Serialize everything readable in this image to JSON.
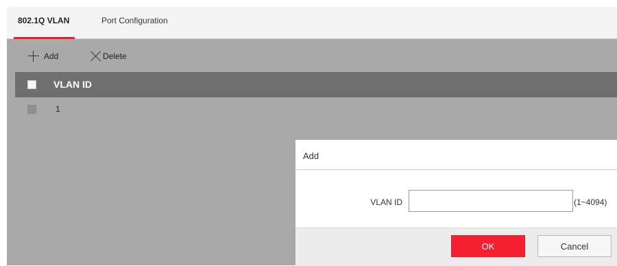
{
  "tabs": [
    {
      "label": "802.1Q VLAN",
      "active": true
    },
    {
      "label": "Port Configuration",
      "active": false
    }
  ],
  "toolbar": {
    "add_label": "Add",
    "add_icon": "plus-icon",
    "delete_label": "Delete",
    "delete_icon": "close-icon"
  },
  "table": {
    "header": "VLAN ID",
    "rows": [
      {
        "vlan_id": "1"
      }
    ]
  },
  "dialog": {
    "title": "Add",
    "field_label": "VLAN ID",
    "field_value": "",
    "field_hint": "(1~4094)",
    "ok_label": "OK",
    "cancel_label": "Cancel"
  },
  "colors": {
    "accent": "#e7212c",
    "overlay": "#a9a9a9",
    "table_header": "#6f6f6f",
    "ok_button": "#f4202f"
  }
}
